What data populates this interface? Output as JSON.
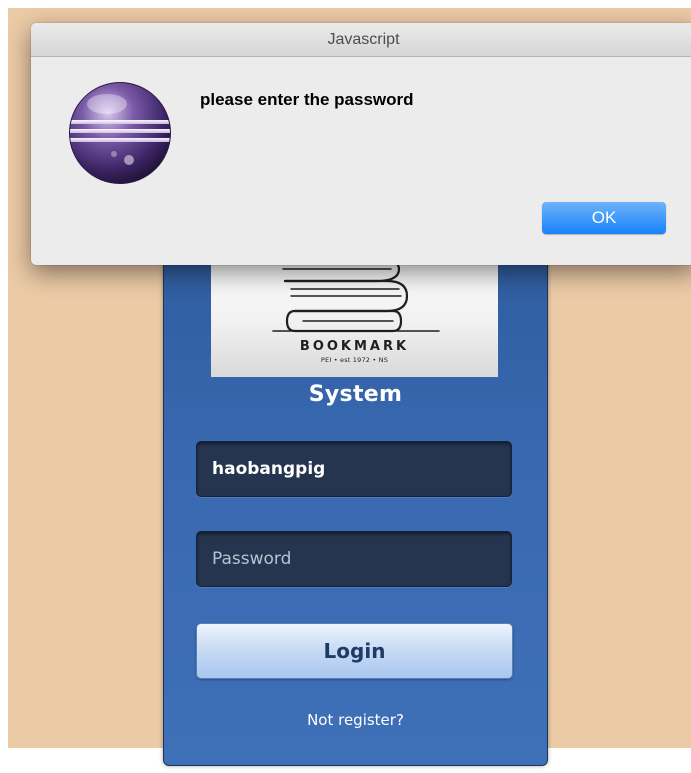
{
  "colors": {
    "page_background": "#ebcaa6",
    "panel_blue": "#3868b0",
    "field_dark": "#25344f",
    "ok_button_blue": "#1a82fb"
  },
  "login": {
    "logo": {
      "brand": "BOOKMARK",
      "tagline": "PEI • est 1972 • NS",
      "icon": "book-stack-icon"
    },
    "system_title": "System",
    "username": {
      "value": "haobangpig"
    },
    "password": {
      "value": "",
      "placeholder": "Password"
    },
    "login_button": "Login",
    "register_link": "Not register?"
  },
  "alert": {
    "title": "Javascript",
    "message": "please enter the password",
    "icon": "eclipse-icon",
    "ok_button": "OK"
  }
}
